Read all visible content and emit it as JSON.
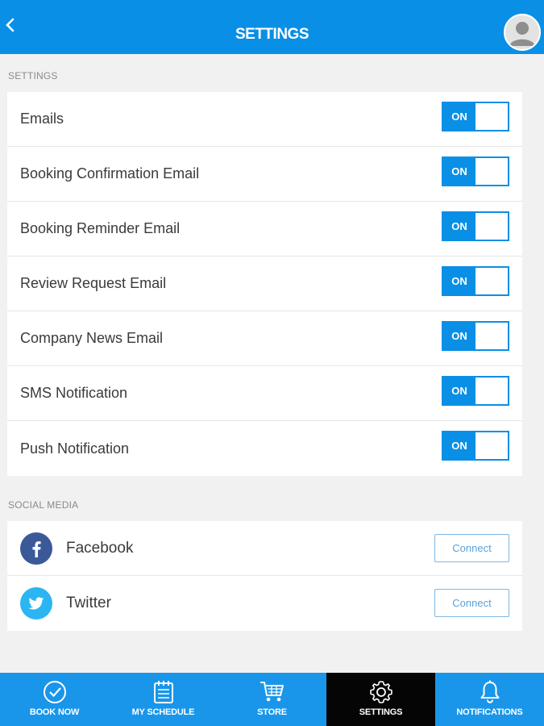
{
  "header": {
    "title": "SETTINGS",
    "back_icon": "chevron-left-icon",
    "avatar_icon": "user-avatar-icon"
  },
  "colors": {
    "primary": "#0a8fe6",
    "nav_background": "#1996ea",
    "nav_active": "#050505",
    "facebook": "#3b5998",
    "twitter": "#1da1f2"
  },
  "settings_section": {
    "label": "SETTINGS",
    "items": [
      {
        "label": "Emails",
        "toggle": "ON"
      },
      {
        "label": "Booking Confirmation Email",
        "toggle": "ON"
      },
      {
        "label": "Booking Reminder Email",
        "toggle": "ON"
      },
      {
        "label": "Review Request Email",
        "toggle": "ON"
      },
      {
        "label": "Company News Email",
        "toggle": "ON"
      },
      {
        "label": "SMS Notification",
        "toggle": "ON"
      },
      {
        "label": "Push Notification",
        "toggle": "ON"
      }
    ]
  },
  "social_section": {
    "label": "SOCIAL MEDIA",
    "items": [
      {
        "label": "Facebook",
        "icon": "facebook-icon",
        "button": "Connect"
      },
      {
        "label": "Twitter",
        "icon": "twitter-icon",
        "button": "Connect"
      }
    ]
  },
  "bottom_nav": {
    "items": [
      {
        "label": "BOOK NOW",
        "icon": "check-circle-icon",
        "active": false
      },
      {
        "label": "MY SCHEDULE",
        "icon": "calendar-icon",
        "active": false
      },
      {
        "label": "STORE",
        "icon": "cart-icon",
        "active": false
      },
      {
        "label": "SETTINGS",
        "icon": "gear-icon",
        "active": true
      },
      {
        "label": "NOTIFICATIONS",
        "icon": "bell-icon",
        "active": false
      }
    ]
  }
}
